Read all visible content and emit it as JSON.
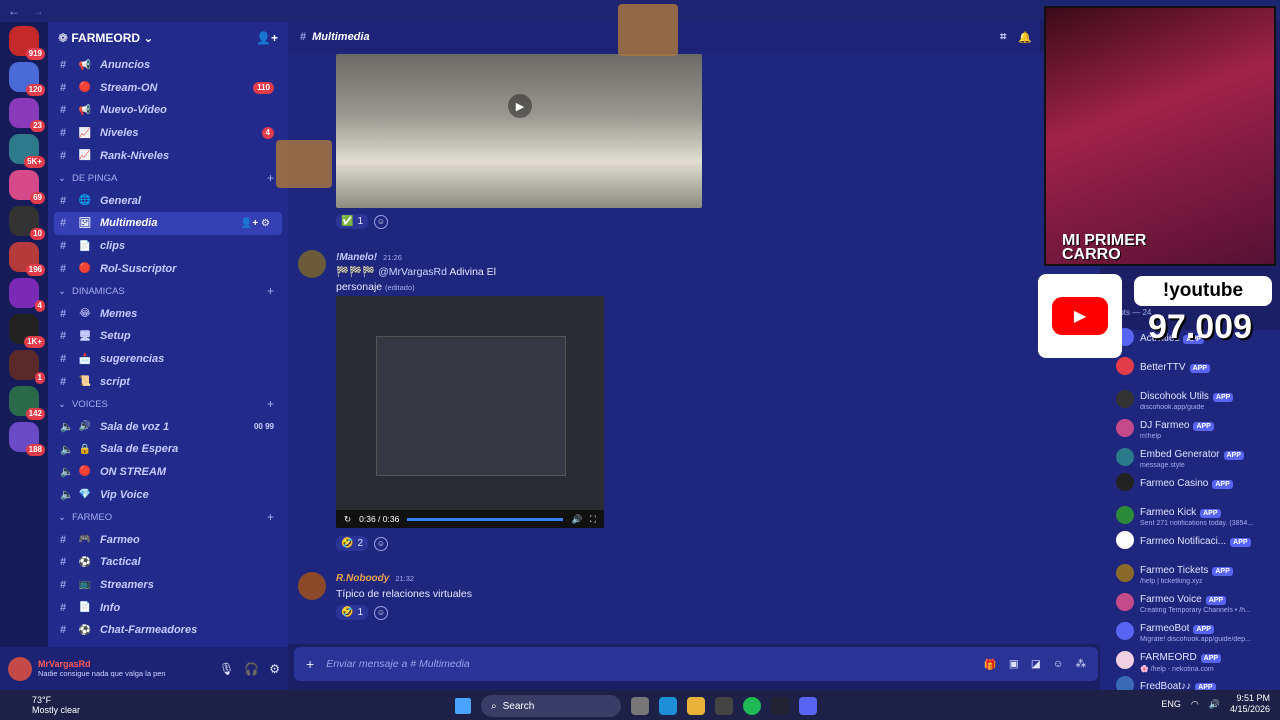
{
  "window": {
    "back": "←",
    "forward": "→"
  },
  "server_badges": [
    "919",
    "120",
    "23",
    "5K+",
    "69",
    "10",
    "196",
    "4",
    "1K+",
    "1",
    "142",
    "188"
  ],
  "guild": {
    "name": "FARMEORD"
  },
  "channel_list": [
    {
      "type": "channel",
      "emoji": "📢",
      "name": "Anuncios"
    },
    {
      "type": "channel",
      "emoji": "🔴",
      "name": "Stream-ON",
      "count": "110"
    },
    {
      "type": "channel",
      "emoji": "📢",
      "name": "Nuevo-Video"
    },
    {
      "type": "channel",
      "emoji": "📈",
      "name": "Niveles",
      "count": "4"
    },
    {
      "type": "channel",
      "emoji": "📈",
      "name": "Rank-Niveles"
    },
    {
      "type": "category",
      "name": "DE PINGA"
    },
    {
      "type": "channel",
      "emoji": "🌐",
      "name": "General"
    },
    {
      "type": "channel",
      "emoji": "🖼",
      "name": "Multimedia",
      "active": true
    },
    {
      "type": "channel",
      "emoji": "📄",
      "name": "clips"
    },
    {
      "type": "channel",
      "emoji": "🔴",
      "name": "Rol-Suscriptor"
    },
    {
      "type": "category",
      "name": "DINAMICAS"
    },
    {
      "type": "channel",
      "emoji": "😂",
      "name": "Memes"
    },
    {
      "type": "channel",
      "emoji": "🖥",
      "name": "Setup"
    },
    {
      "type": "channel",
      "emoji": "📩",
      "name": "sugerencias"
    },
    {
      "type": "channel",
      "emoji": "📜",
      "name": "script"
    },
    {
      "type": "category",
      "name": "VOICES"
    },
    {
      "type": "voice",
      "emoji": "🔊",
      "name": "Sala de voz 1",
      "vc": "00  99"
    },
    {
      "type": "voice",
      "emoji": "🔒",
      "name": "Sala de Espera"
    },
    {
      "type": "voice",
      "emoji": "🔴",
      "name": "ON STREAM"
    },
    {
      "type": "voice",
      "emoji": "💎",
      "name": "Vip Voice"
    },
    {
      "type": "category",
      "name": "FARMEO"
    },
    {
      "type": "channel",
      "emoji": "🎮",
      "name": "Farmeo"
    },
    {
      "type": "channel",
      "emoji": "⚽",
      "name": "Tactical"
    },
    {
      "type": "channel",
      "emoji": "📺",
      "name": "Streamers"
    },
    {
      "type": "channel",
      "emoji": "📄",
      "name": "Info"
    },
    {
      "type": "channel",
      "emoji": "⚽",
      "name": "Chat-Farmeadores"
    }
  ],
  "user": {
    "name": "MrVargasRd",
    "status": "Nadie consigue nada que valga la pen"
  },
  "header": {
    "channel": "Multimedia"
  },
  "messages": {
    "m1_reactions": [
      {
        "emoji": "✅",
        "count": "1"
      }
    ],
    "m2": {
      "author": "!Manelo!",
      "time": "21:26",
      "mention": "@MrVargasRd",
      "text_a": "Adivina El",
      "text_b": "personaje",
      "edited": "(editado)",
      "video_time": "0:36 / 0:36",
      "reactions": [
        {
          "emoji": "🤣",
          "count": "2"
        }
      ]
    },
    "m3": {
      "author": "R.Noboody",
      "time": "21:32",
      "text": "Típico de relaciones virtuales",
      "reactions": [
        {
          "emoji": "🤣",
          "count": "1"
        }
      ]
    }
  },
  "composer": {
    "placeholder": "Enviar mensaje a #",
    "channel": "Multimedia"
  },
  "overlay": {
    "webcam_caption_1": "MI PRIMER",
    "webcam_caption_2": "CARRO",
    "yt_label": "!youtube",
    "subs": "97.009"
  },
  "members_header": "Bots — 24",
  "members": [
    {
      "name": "Activities",
      "sub": ""
    },
    {
      "name": "BetterTTV",
      "sub": ""
    },
    {
      "name": "Discohook Utils",
      "sub": "discohook.app/guide"
    },
    {
      "name": "DJ Farmeo",
      "sub": "m!help"
    },
    {
      "name": "Embed Generator",
      "sub": "message.style"
    },
    {
      "name": "Farmeo Casino",
      "sub": ""
    },
    {
      "name": "Farmeo Kick",
      "sub": "Sent 271 notifications today. (3854..."
    },
    {
      "name": "Farmeo Notificaci...",
      "sub": ""
    },
    {
      "name": "Farmeo Tickets",
      "sub": "/help | ticketking.xyz"
    },
    {
      "name": "Farmeo Voice",
      "sub": "Creating Temporary Channels • /h..."
    },
    {
      "name": "FarmeoBot",
      "sub": "Migrate! discohook.app/guide/dep..."
    },
    {
      "name": "FARMEORD",
      "sub": "🌸 /help - nekotina.com"
    },
    {
      "name": "FredBoat♪♪",
      "sub": ""
    }
  ],
  "app_tag": "APP",
  "taskbar": {
    "temp": "73°F",
    "weather": "Mostly clear",
    "search": "Search",
    "lang": "ENG",
    "time": "9:51 PM",
    "date": "4/15/2026"
  }
}
